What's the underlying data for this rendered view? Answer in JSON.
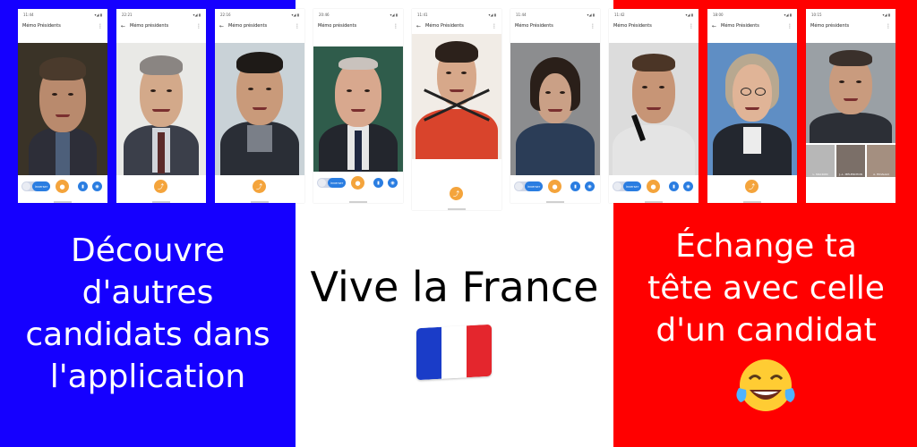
{
  "colors": {
    "blue": "#1500ff",
    "white": "#ffffff",
    "red": "#ff0000",
    "fab": "#f4a43c",
    "accent": "#2a7de1"
  },
  "app_title_a": "Mémo présidents",
  "app_title_b": "Mémo Présidents",
  "caption_left": [
    "Découvre",
    "d'autres",
    "candidats dans",
    "l'application"
  ],
  "center_title": "Vive la France",
  "caption_right": [
    "Échange ta",
    "tête avec celle",
    "d'un candidat"
  ],
  "flag_icon": "french-flag-icon",
  "emoji_icon": "tears-of-joy-emoji-icon",
  "toggle_label": "inverser",
  "thumb_labels": [
    "L. MACRON",
    "J.-L. MÉLENCHON",
    "A. HIDALGO"
  ]
}
